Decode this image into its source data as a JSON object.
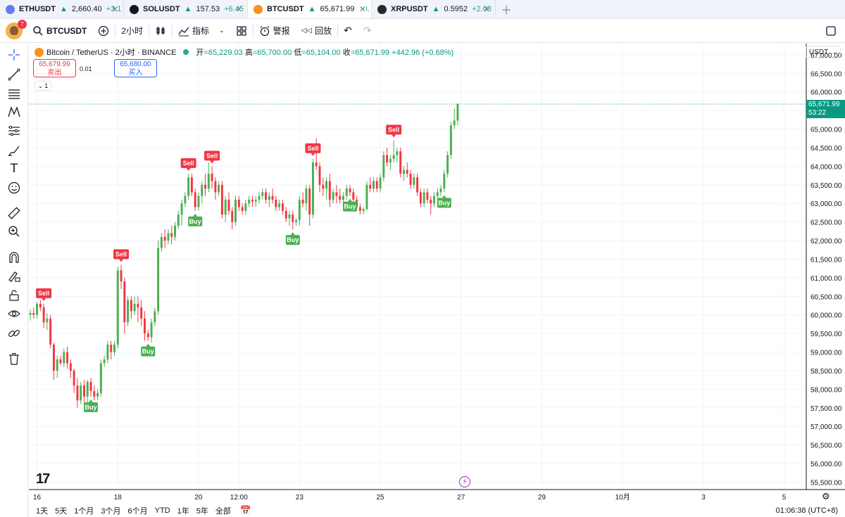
{
  "tabs": [
    {
      "symbol": "ETHUSDT",
      "arrow": "▲",
      "price": "2,660.40",
      "change": "+3.1",
      "coin_color": "#627eea",
      "active": false
    },
    {
      "symbol": "SOLUSDT",
      "arrow": "▲",
      "price": "157.53",
      "change": "+6.45",
      "coin_color": "#131722",
      "active": false
    },
    {
      "symbol": "BTCUSDT",
      "arrow": "▲",
      "price": "65,671.99",
      "change": "+3.",
      "coin_color": "#f7931a",
      "active": true
    },
    {
      "symbol": "XRPUSDT",
      "arrow": "▲",
      "price": "0.5952",
      "change": "+2.08",
      "coin_color": "#23292f",
      "active": false
    }
  ],
  "toolbar": {
    "notifications": "7",
    "symbol": "BTCUSDT",
    "interval": "2小时",
    "indicators": "指标",
    "alert": "警报",
    "replay": "回放"
  },
  "legend": {
    "title": "Bitcoin / TetherUS · 2小时 · BINANCE",
    "open_label": "开",
    "open": "=65,229.03",
    "high_label": "高",
    "high": "=65,700.00",
    "low_label": "低",
    "low": "=65,104.00",
    "close_label": "收",
    "close": "=65,671.99",
    "change": "+442.96 (+0.68%)"
  },
  "trade": {
    "sell_price": "65,679.99",
    "sell_label": "卖出",
    "spread": "0.01",
    "buy_price": "65,680.00",
    "buy_label": "买入",
    "collapse_count": "1"
  },
  "price_axis": {
    "currency": "USDT",
    "last_price": "65,671.99",
    "countdown": "53:22"
  },
  "bottom": {
    "ranges": [
      "1天",
      "5天",
      "1个月",
      "3个月",
      "6个月",
      "YTD",
      "1年",
      "5年",
      "全部"
    ],
    "clock": "01:06:38 (UTC+8)"
  },
  "chart_data": {
    "type": "candlestick",
    "y_range": [
      55300,
      67300
    ],
    "y_ticks": [
      55500,
      56000,
      56500,
      57000,
      57500,
      58000,
      58500,
      59000,
      59500,
      60000,
      60500,
      61000,
      61500,
      62000,
      62500,
      63000,
      63500,
      64000,
      64500,
      65000,
      65500,
      66000,
      66500,
      67000
    ],
    "y_tick_labels": [
      "55,500.00",
      "56,000.00",
      "56,500.00",
      "57,000.00",
      "57,500.00",
      "58,000.00",
      "58,500.00",
      "59,000.00",
      "59,500.00",
      "60,000.00",
      "60,500.00",
      "61,000.00",
      "61,500.00",
      "62,000.00",
      "62,500.00",
      "63,000.00",
      "63,500.00",
      "64,000.00",
      "64,500.00",
      "65,000.00",
      "65,500.00",
      "66,000.00",
      "66,500.00",
      "67,000.00"
    ],
    "x_labels": [
      {
        "bar": 2,
        "label": "16"
      },
      {
        "bar": 26,
        "label": "18"
      },
      {
        "bar": 50,
        "label": "20"
      },
      {
        "bar": 62,
        "label": "12:00"
      },
      {
        "bar": 80,
        "label": "23"
      },
      {
        "bar": 104,
        "label": "25"
      },
      {
        "bar": 128,
        "label": "27"
      },
      {
        "bar": 152,
        "label": "29"
      },
      {
        "bar": 176,
        "label": "10月"
      },
      {
        "bar": 200,
        "label": "3"
      },
      {
        "bar": 224,
        "label": "5"
      }
    ],
    "bars_visible": 231,
    "candles": [
      [
        60000,
        60150,
        59850,
        60050
      ],
      [
        60050,
        60200,
        59900,
        60000
      ],
      [
        60000,
        60350,
        59900,
        60300
      ],
      [
        60300,
        60400,
        60100,
        60200
      ],
      [
        60200,
        60300,
        59650,
        59800
      ],
      [
        59800,
        60050,
        59600,
        59900
      ],
      [
        59900,
        60000,
        59100,
        59200
      ],
      [
        59200,
        59250,
        58250,
        58500
      ],
      [
        58500,
        58900,
        58300,
        58800
      ],
      [
        58800,
        58900,
        58650,
        58700
      ],
      [
        58700,
        59100,
        58600,
        59000
      ],
      [
        59000,
        59150,
        58550,
        58700
      ],
      [
        58700,
        58800,
        58300,
        58500
      ],
      [
        58500,
        58550,
        57900,
        58100
      ],
      [
        58100,
        58300,
        57500,
        57700
      ],
      [
        57700,
        58200,
        57600,
        58100
      ],
      [
        58100,
        58250,
        57650,
        57800
      ],
      [
        57800,
        58250,
        57600,
        58200
      ],
      [
        58200,
        58300,
        57800,
        57950
      ],
      [
        57950,
        58100,
        57700,
        57800
      ],
      [
        57800,
        58000,
        57700,
        57900
      ],
      [
        57900,
        58800,
        57800,
        58700
      ],
      [
        58700,
        58900,
        58600,
        58800
      ],
      [
        58800,
        59300,
        58700,
        59200
      ],
      [
        59200,
        59300,
        58800,
        59000
      ],
      [
        59000,
        59300,
        58900,
        59200
      ],
      [
        59200,
        61300,
        59100,
        61200
      ],
      [
        61200,
        61350,
        60700,
        60900
      ],
      [
        60900,
        61000,
        59500,
        59800
      ],
      [
        59800,
        60500,
        59700,
        60400
      ],
      [
        60400,
        60500,
        59900,
        60100
      ],
      [
        60100,
        60500,
        60000,
        60300
      ],
      [
        60300,
        60500,
        59800,
        60200
      ],
      [
        60200,
        60400,
        59700,
        59900
      ],
      [
        59900,
        60100,
        59300,
        59500
      ],
      [
        59500,
        59600,
        59300,
        59400
      ],
      [
        59400,
        59900,
        59250,
        59800
      ],
      [
        59800,
        60200,
        59700,
        60100
      ],
      [
        60100,
        62000,
        60000,
        61800
      ],
      [
        61800,
        62200,
        61700,
        62100
      ],
      [
        62100,
        62300,
        61800,
        62000
      ],
      [
        62000,
        62300,
        61900,
        62200
      ],
      [
        62200,
        62400,
        61900,
        62100
      ],
      [
        62100,
        62500,
        62000,
        62400
      ],
      [
        62400,
        62800,
        62300,
        62700
      ],
      [
        62700,
        63100,
        62400,
        63000
      ],
      [
        63000,
        63300,
        62900,
        63200
      ],
      [
        63200,
        63800,
        63100,
        63700
      ],
      [
        63700,
        63800,
        63200,
        63300
      ],
      [
        63300,
        63400,
        62800,
        62900
      ],
      [
        62900,
        63300,
        62800,
        63200
      ],
      [
        63200,
        63600,
        63000,
        63500
      ],
      [
        63500,
        63800,
        63200,
        63400
      ],
      [
        63400,
        64100,
        63300,
        63800
      ],
      [
        63800,
        64000,
        63400,
        63600
      ],
      [
        63600,
        63700,
        63100,
        63300
      ],
      [
        63300,
        63600,
        63200,
        63500
      ],
      [
        63500,
        63600,
        62600,
        62700
      ],
      [
        62700,
        63200,
        62500,
        63100
      ],
      [
        63100,
        63300,
        62700,
        62800
      ],
      [
        62800,
        62900,
        62300,
        62500
      ],
      [
        62500,
        63200,
        62400,
        63100
      ],
      [
        63100,
        63200,
        62800,
        62900
      ],
      [
        62900,
        63000,
        62700,
        62800
      ],
      [
        62800,
        63100,
        62700,
        63000
      ],
      [
        63000,
        63200,
        62900,
        63100
      ],
      [
        63100,
        63200,
        62900,
        63050
      ],
      [
        63050,
        63200,
        62900,
        63100
      ],
      [
        63100,
        63300,
        63000,
        63200
      ],
      [
        63200,
        63400,
        63100,
        63300
      ],
      [
        63300,
        63400,
        63000,
        63100
      ],
      [
        63100,
        63300,
        62900,
        63200
      ],
      [
        63200,
        63400,
        63000,
        63100
      ],
      [
        63100,
        63200,
        62800,
        62900
      ],
      [
        62900,
        63100,
        62800,
        63000
      ],
      [
        63000,
        63100,
        62700,
        62800
      ],
      [
        62800,
        62900,
        62500,
        62600
      ],
      [
        62600,
        62800,
        62400,
        62700
      ],
      [
        62700,
        62800,
        62300,
        62500
      ],
      [
        62500,
        62600,
        62400,
        62550
      ],
      [
        62550,
        63200,
        62400,
        63100
      ],
      [
        63100,
        63300,
        62900,
        63000
      ],
      [
        63000,
        63500,
        62800,
        63400
      ],
      [
        63400,
        63500,
        62400,
        62700
      ],
      [
        62700,
        64200,
        62600,
        64100
      ],
      [
        64100,
        64750,
        63900,
        64000
      ],
      [
        64000,
        64100,
        63300,
        63500
      ],
      [
        63500,
        63700,
        63200,
        63400
      ],
      [
        63400,
        63700,
        63100,
        63600
      ],
      [
        63600,
        63800,
        62900,
        63100
      ],
      [
        63100,
        63400,
        63000,
        63300
      ],
      [
        63300,
        63500,
        63000,
        63200
      ],
      [
        63200,
        63400,
        63000,
        63100
      ],
      [
        63100,
        63300,
        62900,
        63200
      ],
      [
        63200,
        63500,
        63100,
        63400
      ],
      [
        63400,
        63500,
        63200,
        63300
      ],
      [
        63300,
        63400,
        62900,
        63100
      ],
      [
        63100,
        63200,
        62800,
        62900
      ],
      [
        62900,
        63000,
        62700,
        62800
      ],
      [
        62800,
        62900,
        62700,
        62850
      ],
      [
        62850,
        63600,
        62800,
        63500
      ],
      [
        63500,
        63700,
        63300,
        63400
      ],
      [
        63400,
        63700,
        63300,
        63600
      ],
      [
        63600,
        63700,
        63300,
        63400
      ],
      [
        63400,
        63800,
        63300,
        63700
      ],
      [
        63700,
        64400,
        63600,
        64300
      ],
      [
        64300,
        64500,
        64000,
        64100
      ],
      [
        64100,
        64300,
        63900,
        64200
      ],
      [
        64200,
        64700,
        64100,
        64300
      ],
      [
        64300,
        64500,
        64100,
        64400
      ],
      [
        64400,
        64500,
        63700,
        63800
      ],
      [
        63800,
        64000,
        63600,
        63900
      ],
      [
        63900,
        64100,
        63700,
        63800
      ],
      [
        63800,
        63900,
        63400,
        63500
      ],
      [
        63500,
        63800,
        63400,
        63700
      ],
      [
        63700,
        63800,
        63200,
        63300
      ],
      [
        63300,
        63400,
        62900,
        63000
      ],
      [
        63000,
        63400,
        62900,
        63300
      ],
      [
        63300,
        63400,
        63000,
        63100
      ],
      [
        63100,
        63200,
        62700,
        63000
      ],
      [
        63000,
        63300,
        62900,
        63200
      ],
      [
        63200,
        63400,
        63100,
        63300
      ],
      [
        63300,
        63500,
        63200,
        63400
      ],
      [
        63400,
        63900,
        63300,
        63800
      ],
      [
        63800,
        64400,
        63700,
        64300
      ],
      [
        64300,
        65200,
        64200,
        65100
      ],
      [
        65100,
        65550,
        65000,
        65229
      ],
      [
        65229,
        65700,
        65104,
        65672
      ]
    ],
    "signals": [
      {
        "bar": 4,
        "type": "sell",
        "label": "Sell"
      },
      {
        "bar": 18,
        "type": "buy",
        "label": "Buy"
      },
      {
        "bar": 27,
        "type": "sell",
        "label": "Sell"
      },
      {
        "bar": 35,
        "type": "buy",
        "label": "Buy"
      },
      {
        "bar": 47,
        "type": "sell",
        "label": "Sell"
      },
      {
        "bar": 49,
        "type": "buy",
        "label": "Buy"
      },
      {
        "bar": 54,
        "type": "sell",
        "label": "Sell"
      },
      {
        "bar": 78,
        "type": "buy",
        "label": "Buy"
      },
      {
        "bar": 84,
        "type": "sell",
        "label": "Sell"
      },
      {
        "bar": 95,
        "type": "buy",
        "label": "Buy"
      },
      {
        "bar": 108,
        "type": "sell",
        "label": "Sell"
      },
      {
        "bar": 123,
        "type": "buy",
        "label": "Buy"
      }
    ],
    "colors": {
      "up": "#4caf50",
      "down": "#f23645",
      "last_line": "#089981",
      "grid": "#f0f3fa"
    }
  }
}
